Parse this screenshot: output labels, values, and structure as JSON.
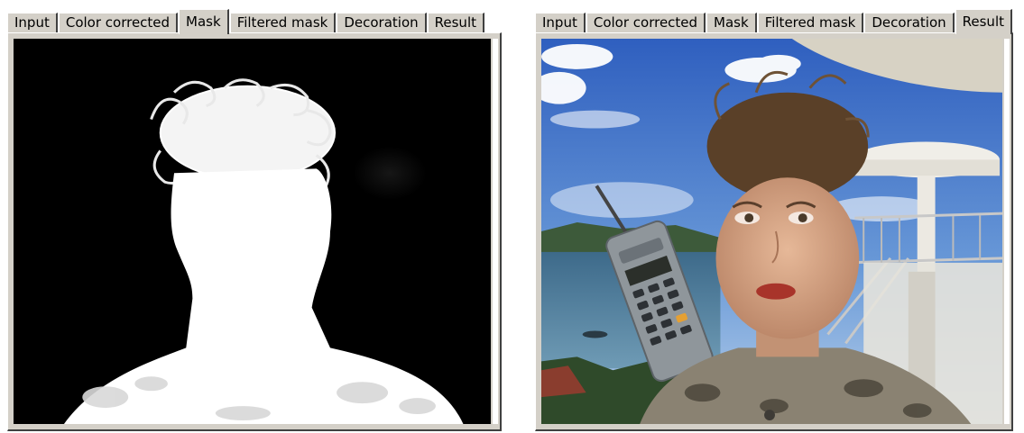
{
  "left_panel": {
    "tabs": [
      "Input",
      "Color corrected",
      "Mask",
      "Filtered mask",
      "Decoration",
      "Result"
    ],
    "active_tab": "Mask"
  },
  "right_panel": {
    "tabs": [
      "Input",
      "Color corrected",
      "Mask",
      "Filtered mask",
      "Decoration",
      "Result"
    ],
    "active_tab": "Result"
  },
  "colors": {
    "tab_face": "#d4d0c8",
    "tab_highlight": "#ffffff",
    "tab_shadow": "#404040",
    "mask_background": "#000000",
    "mask_foreground": "#ffffff",
    "sky": "#3f6fc8"
  }
}
